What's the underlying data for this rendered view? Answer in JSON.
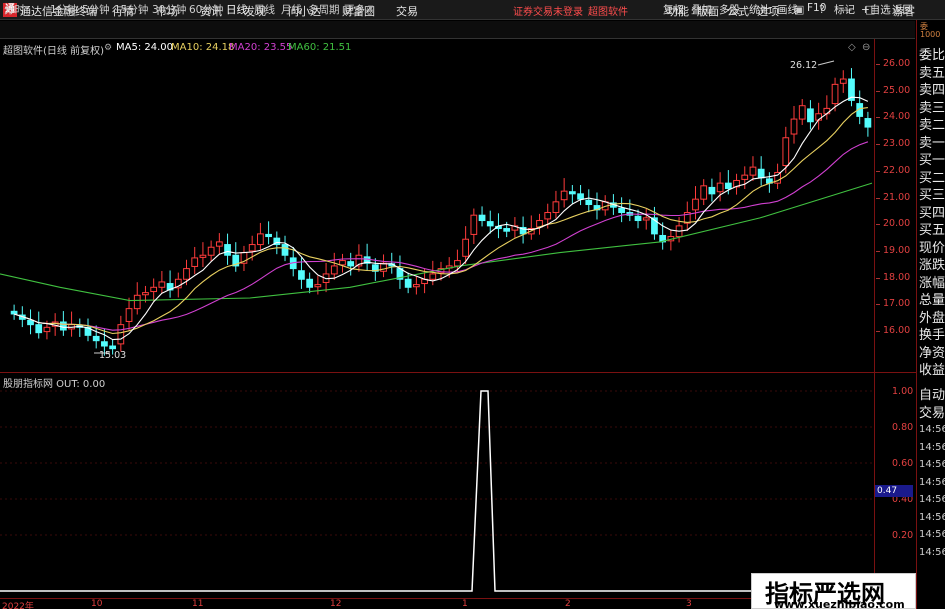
{
  "menubar": {
    "logo": "通",
    "app_name": "通达信金融终端",
    "items": [
      "行情",
      "市场",
      "资讯",
      "发现",
      "问小达",
      "财富圈",
      "交易"
    ],
    "notice": "证券交易未登录",
    "notice2": "超图软件",
    "right_items": [
      "功能",
      "版面",
      "公式",
      "选项"
    ],
    "login": "游客"
  },
  "toolbar": {
    "periods": [
      "分时",
      "1分钟",
      "5分钟",
      "15分钟",
      "30分钟",
      "60分钟",
      "日线",
      "周线",
      "月线",
      "多周期",
      "更多"
    ],
    "active": "日线",
    "right": [
      "复权",
      "叠加",
      "多股",
      "统计",
      "画线",
      "F10",
      "标记",
      "+自选",
      "返回"
    ]
  },
  "chart": {
    "title": "超图软件(日线 前复权)",
    "ma": [
      {
        "label": "MA5: 24.00",
        "color": "#ffffff"
      },
      {
        "label": "MA10: 24.18",
        "color": "#e8d060"
      },
      {
        "label": "MA20: 23.55",
        "color": "#d040d0"
      },
      {
        "label": "MA60: 21.51",
        "color": "#40c040"
      }
    ],
    "y_labels": [
      "26.00",
      "25.00",
      "24.00",
      "23.00",
      "22.00",
      "21.00",
      "20.00",
      "19.00",
      "18.00",
      "17.00",
      "16.00"
    ],
    "high_label": "26.12",
    "low_label": "15.03"
  },
  "indicator": {
    "title": "股朋指标网 OUT: 0.00",
    "y_labels": [
      "1.00",
      "0.80",
      "0.60",
      "0.40",
      "0.20"
    ],
    "current": "0.47"
  },
  "right_panel": {
    "top_small": "委",
    "top_small2": "1000",
    "items": [
      "委比",
      "卖五",
      "卖四",
      "卖三",
      "卖二",
      "卖一",
      "买一",
      "买二",
      "买三",
      "买四",
      "买五",
      "现价",
      "涨跌",
      "涨幅",
      "总量",
      "外盘",
      "换手",
      "净资",
      "收益"
    ],
    "lower_items": [
      "自动",
      "交易"
    ],
    "times": [
      "14:56",
      "14:56",
      "14:56",
      "14:56",
      "14:56",
      "14:56",
      "14:56",
      "14:56"
    ]
  },
  "x_axis": [
    "2022年",
    "10",
    "11",
    "12",
    "1",
    "2",
    "3"
  ],
  "watermark": {
    "title": "指标严选网",
    "url": "www.xuezhibiao.com"
  },
  "chart_data": {
    "type": "candlestick",
    "title": "超图软件(日线 前复权)",
    "ylim": [
      15,
      26.5
    ],
    "x_months": [
      "2022年",
      "10",
      "11",
      "12",
      "1",
      "2",
      "3"
    ],
    "closes": [
      16.6,
      16.4,
      16.2,
      15.9,
      16.1,
      16.3,
      16.0,
      16.2,
      16.1,
      15.8,
      15.6,
      15.4,
      15.3,
      16.2,
      16.8,
      17.3,
      17.4,
      17.6,
      17.8,
      17.5,
      17.9,
      18.3,
      18.7,
      18.8,
      19.1,
      19.3,
      18.8,
      18.4,
      18.9,
      19.2,
      19.6,
      19.5,
      19.2,
      18.8,
      18.3,
      17.9,
      17.6,
      17.7,
      18.1,
      18.4,
      18.6,
      18.4,
      18.8,
      18.5,
      18.2,
      18.5,
      18.4,
      17.9,
      17.6,
      17.7,
      17.9,
      18.1,
      18.3,
      18.4,
      18.6,
      19.4,
      20.3,
      20.1,
      19.9,
      19.8,
      19.7,
      19.9,
      19.6,
      19.8,
      20.1,
      20.4,
      20.8,
      21.2,
      21.1,
      20.9,
      20.7,
      20.5,
      20.8,
      20.6,
      20.4,
      20.3,
      20.1,
      20.2,
      19.6,
      19.3,
      19.5,
      19.9,
      20.4,
      20.9,
      21.4,
      21.1,
      21.5,
      21.3,
      21.6,
      21.8,
      22.1,
      21.7,
      21.5,
      21.9,
      23.2,
      23.9,
      24.4,
      23.8,
      24.1,
      24.3,
      25.2,
      25.4,
      24.6,
      24.0,
      23.6
    ],
    "out_series_note": "indicator spike to 1.00 around mid-January",
    "ma5_last": 24.0,
    "ma10_last": 24.18,
    "ma20_last": 23.55,
    "ma60_last": 21.51
  }
}
